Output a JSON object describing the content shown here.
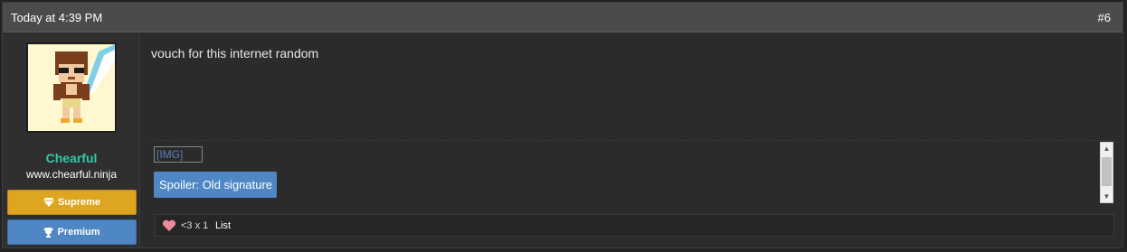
{
  "post": {
    "date": "Today at 4:39 PM",
    "number": "#6",
    "message": "vouch for this internet random"
  },
  "user": {
    "name": "Chearful",
    "title": "www.chearful.ninja",
    "badges": [
      {
        "label": "Supreme",
        "icon": "diamond-icon",
        "color": "#dea520"
      },
      {
        "label": "Premium",
        "icon": "trophy-icon",
        "color": "#4f87c4"
      }
    ]
  },
  "signature": {
    "image_alt": "[IMG]",
    "spoiler_label": "Spoiler: Old signature"
  },
  "reactions": {
    "icon": "heart-icon",
    "summary": "<3 x 1",
    "list_label": "List"
  },
  "colors": {
    "header_bg": "#4b4b4b",
    "username": "#33c8a5",
    "supreme": "#dea520",
    "premium": "#4f87c4"
  }
}
